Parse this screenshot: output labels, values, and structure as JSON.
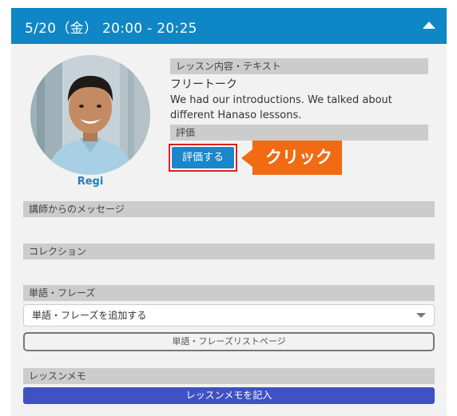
{
  "header": {
    "title": "5/20（金） 20:00 - 20:25",
    "collapse_icon": "chevron-up-icon"
  },
  "tutor": {
    "name": "Regi",
    "photo": "tutor-photo"
  },
  "lesson": {
    "section_label": "レッスン内容・テキスト",
    "topic": "フリートーク",
    "description": "We had our introductions. We talked about different Hanaso lessons."
  },
  "rating": {
    "section_label": "評価",
    "button_label": "評価する"
  },
  "annotation": {
    "callout_label": "クリック"
  },
  "message": {
    "section_label": "講師からのメッセージ"
  },
  "collection": {
    "section_label": "コレクション"
  },
  "phrases": {
    "section_label": "単語・フレーズ",
    "select_value": "単語・フレーズを追加する",
    "list_page_button": "単語・フレーズリストページ"
  },
  "memo": {
    "section_label": "レッスンメモ",
    "button_label": "レッスンメモを記入"
  },
  "colors": {
    "header": "#0f86c5",
    "rate_button": "#1987c9",
    "callout": "#f26a11",
    "highlight_border": "#e01e1e",
    "memo_button": "#3f51c4",
    "tutor_name": "#1f7fc4"
  }
}
